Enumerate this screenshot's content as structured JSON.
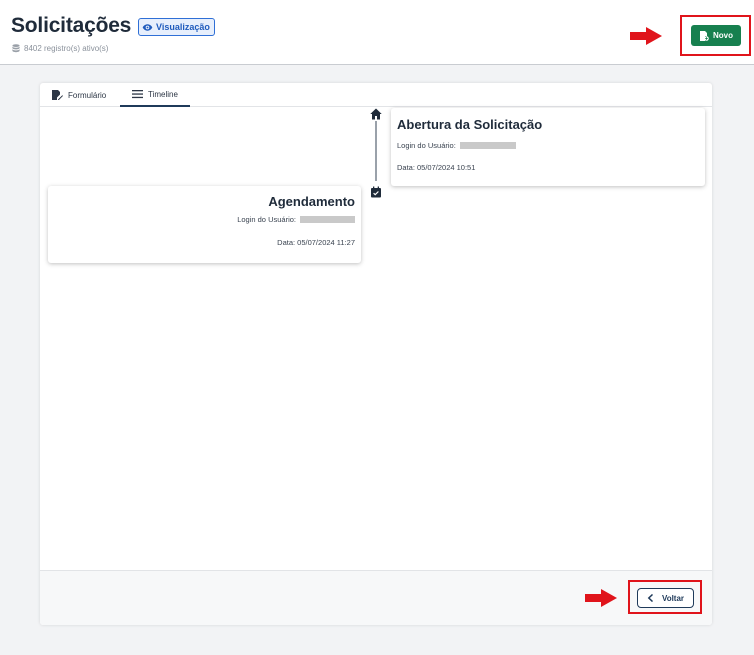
{
  "header": {
    "title": "Solicitações",
    "mode_badge": "Visualização",
    "records": "8402 registro(s) ativo(s)",
    "new_button": "Novo"
  },
  "tabs": [
    {
      "label": "Formulário",
      "icon": "edit-form-icon"
    },
    {
      "label": "Timeline",
      "icon": "list-icon",
      "active": true
    }
  ],
  "timeline": {
    "events": [
      {
        "icon": "home-icon",
        "title": "Abertura da Solicitação",
        "login_label": "Login do Usuário:",
        "date": "Data: 05/07/2024 10:51"
      },
      {
        "icon": "calendar-check-icon",
        "title": "Agendamento",
        "login_label": "Login do Usuário:",
        "date": "Data: 05/07/2024 11:27"
      }
    ]
  },
  "footer": {
    "back_button": "Voltar"
  },
  "colors": {
    "primary_green": "#17804f",
    "annotation_red": "#e0141b",
    "badge_blue": "#2f6fd6",
    "navy": "#1f3a5a"
  }
}
